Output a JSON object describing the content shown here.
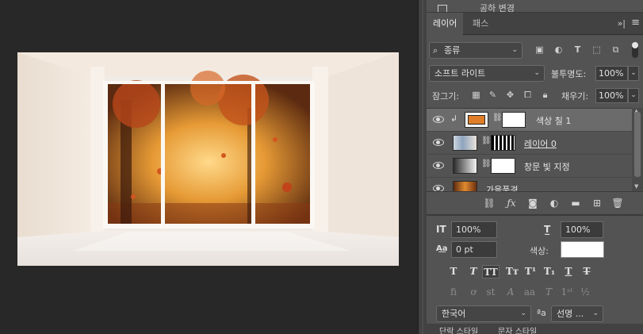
{
  "history": {
    "label": "공하 변경"
  },
  "layers_panel": {
    "tabs": [
      {
        "label": "레이어",
        "active": true
      },
      {
        "label": "패스",
        "active": false
      }
    ],
    "collapse_glyph": "»|",
    "menu_glyph": "≡",
    "filter_kind": "종류",
    "blend_mode": "소프트 라이트",
    "opacity_label": "불투명도:",
    "opacity_value": "100%",
    "lock_label": "잠그기:",
    "fill_label": "채우기:",
    "fill_value": "100%",
    "layers": [
      {
        "name": "색상 칠 1",
        "type": "solid-color",
        "selected": true,
        "clipped": true,
        "thumb_color": "#e07e2a"
      },
      {
        "name": "레이어 0",
        "type": "image-with-mask",
        "selected": false,
        "clipped": false
      },
      {
        "name": "창문 빛 지정",
        "type": "gradient-with-mask",
        "selected": false,
        "clipped": false
      },
      {
        "name": "가을풍경",
        "type": "image",
        "selected": false,
        "clipped": false
      }
    ]
  },
  "character_panel": {
    "font_size": "100%",
    "leading": "100%",
    "tracking": "0 pt",
    "color_label": "색상:",
    "color_value": "#ffffff",
    "language": "한국어",
    "antialias": "선명 ..."
  },
  "bottom_tabs": [
    "단락 스타일",
    "문자 스타일"
  ],
  "colors": {
    "canvas_bg": "#282828",
    "panel_bg": "#535353",
    "selected_row": "#6b6b6b",
    "accent_orange": "#e07e2a"
  }
}
